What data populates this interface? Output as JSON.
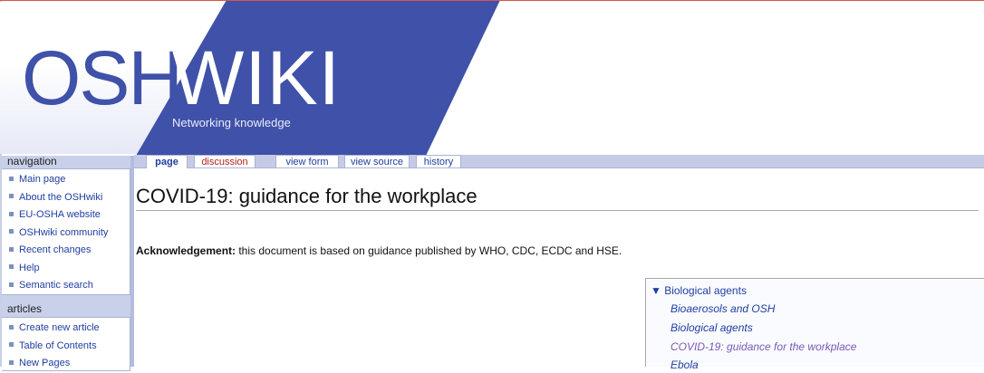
{
  "logo": {
    "osh": "OSH",
    "wiki": "WIKI",
    "tagline": "Networking knowledge"
  },
  "colors": {
    "brand_blue": "#3f51a8",
    "link": "#1f3ea0",
    "new_link": "#b22222"
  },
  "sidebar": {
    "navigation": {
      "title": "navigation",
      "items": [
        "Main page",
        "About the OSHwiki",
        "EU-OSHA website",
        "OSHwiki community",
        "Recent changes",
        "Help",
        "Semantic search"
      ]
    },
    "articles": {
      "title": "articles",
      "items": [
        "Create new article",
        "Table of Contents",
        "New Pages"
      ]
    }
  },
  "tabs": {
    "page": "page",
    "discussion": "discussion",
    "view_form": "view form",
    "view_source": "view source",
    "history": "history"
  },
  "content": {
    "title": "COVID-19: guidance for the workplace",
    "ack_label": "Acknowledgement:",
    "ack_text": " this document is based on guidance published by WHO, CDC, ECDC and HSE."
  },
  "navbox": {
    "heading": "▼ Biological agents",
    "items": [
      "Bioaerosols and OSH",
      "Biological agents",
      "COVID-19: guidance for the workplace",
      "Ebola"
    ]
  }
}
